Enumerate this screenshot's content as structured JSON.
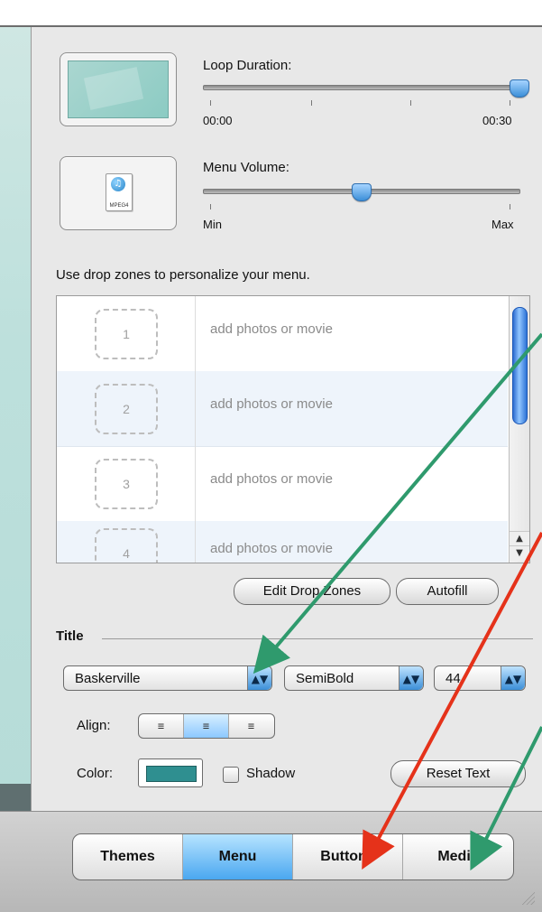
{
  "panel": {
    "loop_duration": {
      "label": "Loop Duration:",
      "min_label": "00:00",
      "max_label": "00:30",
      "value": 30,
      "max": 30
    },
    "menu_volume": {
      "label": "Menu Volume:",
      "min_label": "Min",
      "max_label": "Max",
      "value": 0.5
    },
    "media_icon": {
      "label": "MPEG4",
      "icon": "mpeg4-file-icon"
    },
    "dropzones": {
      "hint": "Use drop zones to personalize your menu.",
      "rows": [
        {
          "number": "1",
          "text": "add photos or movie"
        },
        {
          "number": "2",
          "text": "add photos or movie"
        },
        {
          "number": "3",
          "text": "add photos or movie"
        },
        {
          "number": "4",
          "text": "add photos or movie"
        }
      ]
    },
    "buttons": {
      "edit_dropzones": "Edit Drop Zones",
      "autofill": "Autofill",
      "reset_text": "Reset Text"
    },
    "title_section": {
      "heading": "Title",
      "font_family": "Baskerville",
      "font_weight": "SemiBold",
      "font_size": "44",
      "align_label": "Align:",
      "align_active": "center",
      "color_label": "Color:",
      "shadow_label": "Shadow",
      "color": "#2f8f90"
    }
  },
  "tabs": {
    "items": [
      {
        "label": "Themes"
      },
      {
        "label": "Menu"
      },
      {
        "label": "Buttons"
      },
      {
        "label": "Media"
      }
    ],
    "active_index": 1
  },
  "overlay": {
    "green": "#2f9a6d",
    "red": "#e5321a"
  }
}
